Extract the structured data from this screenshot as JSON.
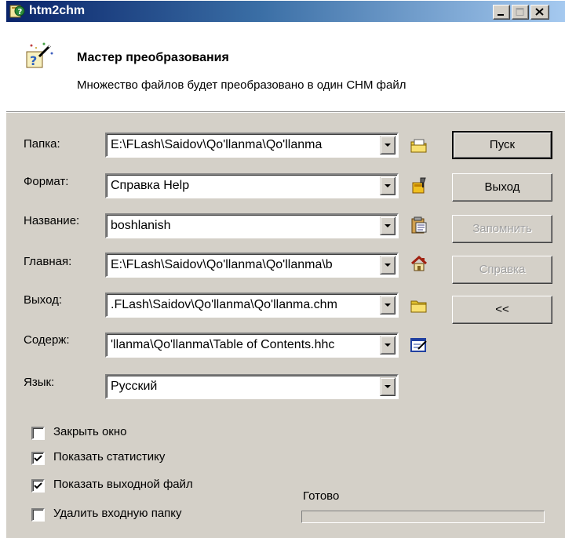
{
  "window": {
    "title": "htm2chm",
    "controls": {
      "minimize": "_",
      "maximize": "□",
      "close": "×"
    }
  },
  "header": {
    "title": "Мастер преобразования",
    "subtitle": "Множество файлов будет преобразовано в один CHM файл",
    "icon": "wizard-wand-icon"
  },
  "form": {
    "folder": {
      "label": "Папка:",
      "value": "E:\\FLash\\Saidov\\Qo'llanma\\Qo'llanma",
      "icon": "folder-browse-icon"
    },
    "format": {
      "label": "Формат:",
      "value": "Справка Help",
      "icon": "format-settings-icon"
    },
    "name": {
      "label": "Название:",
      "value": "boshlanish",
      "icon": "clipboard-icon"
    },
    "main": {
      "label": "Главная:",
      "value": "E:\\FLash\\Saidov\\Qo'llanma\\Qo'llanma\\b",
      "icon": "home-icon"
    },
    "output": {
      "label": "Выход:",
      "value": ".FLash\\Saidov\\Qo'llanma\\Qo'llanma.chm",
      "icon": "folder-open-icon"
    },
    "contents": {
      "label": "Содерж:",
      "value": "'llanma\\Qo'llanma\\Table of Contents.hhc",
      "icon": "edit-contents-icon"
    },
    "language": {
      "label": "Язык:",
      "value": "Русский"
    }
  },
  "buttons": {
    "start": "Пуск",
    "exit": "Выход",
    "remember": "Запомнить",
    "help": "Справка",
    "collapse": "<<"
  },
  "options": [
    {
      "label": "Закрыть окно",
      "checked": false
    },
    {
      "label": "Показать статистику",
      "checked": true
    },
    {
      "label": "Показать выходной файл",
      "checked": true
    },
    {
      "label": "Удалить входную папку",
      "checked": false
    }
  ],
  "status": {
    "text": "Готово",
    "progress": 0
  },
  "colors": {
    "titlebar_start": "#0a246a",
    "titlebar_end": "#a6caf0",
    "face": "#d4d0c8"
  }
}
